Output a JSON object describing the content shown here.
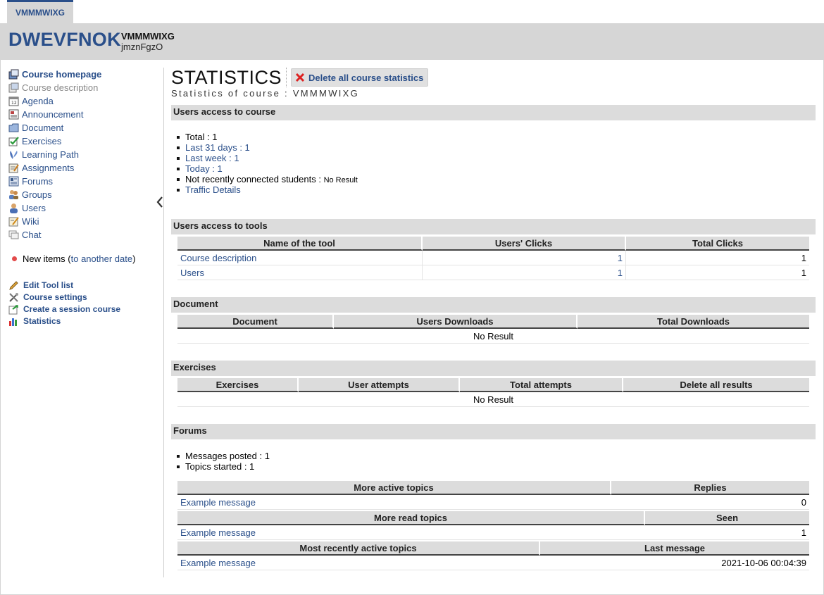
{
  "tab": {
    "label": "VMMMWIXG"
  },
  "header": {
    "site_title": "DWEVFNOK",
    "course_code": "VMMMWIXG",
    "course_subtitle": "jmznFgzO"
  },
  "sidebar": {
    "items": [
      {
        "label": "Course homepage",
        "icon": "home-icon",
        "bold": true
      },
      {
        "label": "Course description",
        "icon": "description-icon",
        "disabled": true
      },
      {
        "label": "Agenda",
        "icon": "calendar-icon"
      },
      {
        "label": "Announcement",
        "icon": "announcement-icon"
      },
      {
        "label": "Document",
        "icon": "folder-icon"
      },
      {
        "label": "Exercises",
        "icon": "checkmark-icon"
      },
      {
        "label": "Learning Path",
        "icon": "learning-path-icon"
      },
      {
        "label": "Assignments",
        "icon": "assignment-icon"
      },
      {
        "label": "Forums",
        "icon": "forum-icon"
      },
      {
        "label": "Groups",
        "icon": "groups-icon"
      },
      {
        "label": "Users",
        "icon": "user-icon"
      },
      {
        "label": "Wiki",
        "icon": "wiki-icon"
      },
      {
        "label": "Chat",
        "icon": "chat-icon"
      }
    ],
    "new_items_prefix": "New items (",
    "new_items_link": "to another date",
    "new_items_suffix": ")",
    "admin": [
      {
        "label": "Edit Tool list",
        "icon": "pencil-icon"
      },
      {
        "label": "Course settings",
        "icon": "tools-icon"
      },
      {
        "label": "Create a session course",
        "icon": "session-icon"
      },
      {
        "label": "Statistics",
        "icon": "bar-chart-icon"
      }
    ]
  },
  "main": {
    "title": "STATISTICS",
    "delete_all_label": "Delete all course statistics",
    "subtitle": "Statistics of course : VMMMWIXG",
    "access": {
      "header": "Users access to course",
      "total_label": "Total : ",
      "total_value": "1",
      "last31": "Last 31 days : 1",
      "lastweek": "Last week : 1",
      "today": "Today : 1",
      "not_recent_label": "Not recently connected students : ",
      "not_recent_value": "No Result",
      "traffic": "Traffic Details"
    },
    "tools": {
      "header": "Users access to tools",
      "columns": [
        "Name of the tool",
        "Users' Clicks",
        "Total Clicks"
      ],
      "rows": [
        {
          "name": "Course description",
          "users_clicks": "1",
          "total_clicks": "1"
        },
        {
          "name": "Users",
          "users_clicks": "1",
          "total_clicks": "1"
        }
      ]
    },
    "document": {
      "header": "Document",
      "columns": [
        "Document",
        "Users Downloads",
        "Total Downloads"
      ],
      "empty": "No Result"
    },
    "exercises": {
      "header": "Exercises",
      "columns": [
        "Exercises",
        "User attempts",
        "Total attempts",
        "Delete all results"
      ],
      "empty": "No Result"
    },
    "forums": {
      "header": "Forums",
      "messages_posted": "Messages posted : 1",
      "topics_started": "Topics started : 1",
      "active": {
        "columns": [
          "More active topics",
          "Replies"
        ],
        "topic": "Example message",
        "value": "0"
      },
      "read": {
        "columns": [
          "More read topics",
          "Seen"
        ],
        "topic": "Example message",
        "value": "1"
      },
      "recent": {
        "columns": [
          "Most recently active topics",
          "Last message"
        ],
        "topic": "Example message",
        "value": "2021-10-06 00:04:39"
      }
    }
  }
}
